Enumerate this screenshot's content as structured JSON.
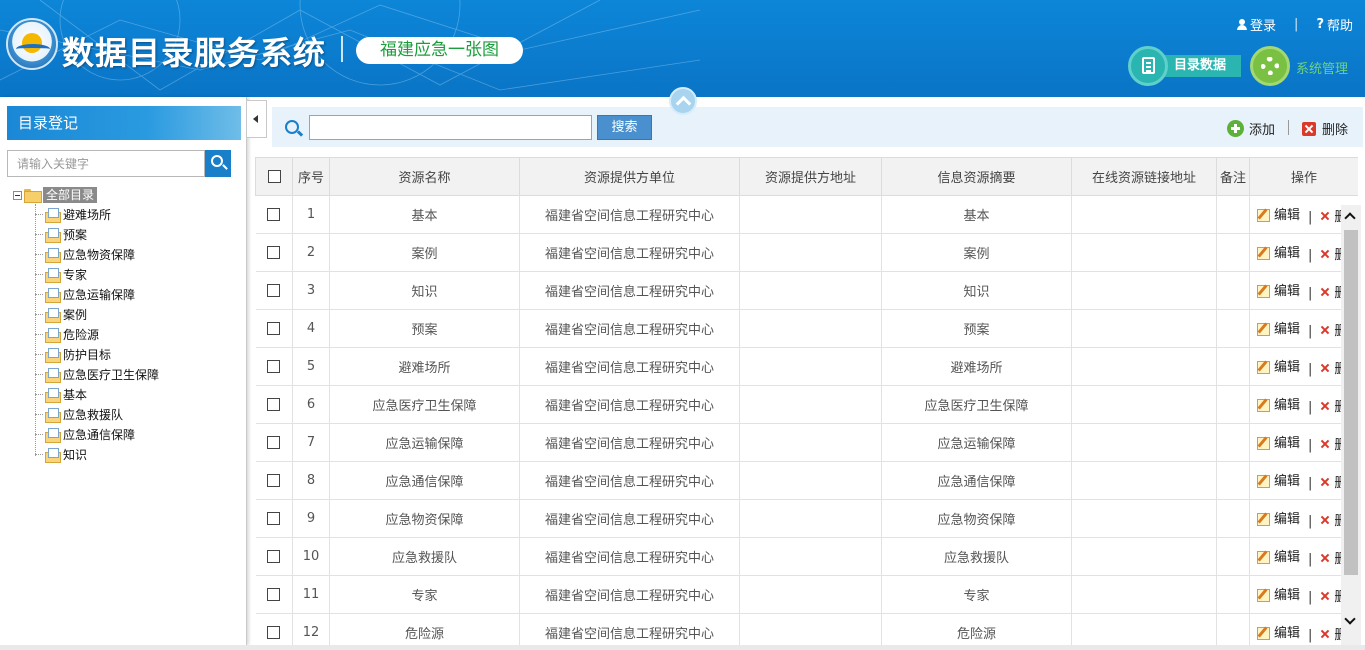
{
  "header": {
    "app_title": "数据目录服务系统",
    "subtitle": "福建应急一张图",
    "login_label": "登录",
    "help_label": "帮助",
    "nav": {
      "catalog_data": "目录数据",
      "system_admin": "系统管理"
    }
  },
  "sidebar": {
    "title": "目录登记",
    "search_placeholder": "请输入关键字",
    "tree": {
      "root": "全部目录",
      "items": [
        {
          "label": "避难场所"
        },
        {
          "label": "预案"
        },
        {
          "label": "应急物资保障"
        },
        {
          "label": "专家"
        },
        {
          "label": "应急运输保障"
        },
        {
          "label": "案例"
        },
        {
          "label": "危险源"
        },
        {
          "label": "防护目标"
        },
        {
          "label": "应急医疗卫生保障"
        },
        {
          "label": "基本"
        },
        {
          "label": "应急救援队"
        },
        {
          "label": "应急通信保障"
        },
        {
          "label": "知识"
        }
      ]
    }
  },
  "toolbar": {
    "search_value": "",
    "search_button": "搜索",
    "add_label": "添加",
    "delete_label": "删除"
  },
  "table": {
    "columns": [
      "序号",
      "资源名称",
      "资源提供方单位",
      "资源提供方地址",
      "信息资源摘要",
      "在线资源链接地址",
      "备注",
      "操作"
    ],
    "edit_label": "编辑",
    "delete_label": "删除",
    "rows": [
      {
        "no": "1",
        "name": "基本",
        "provider": "福建省空间信息工程研究中心",
        "address": "",
        "summary": "基本",
        "link": "",
        "note": ""
      },
      {
        "no": "2",
        "name": "案例",
        "provider": "福建省空间信息工程研究中心",
        "address": "",
        "summary": "案例",
        "link": "",
        "note": ""
      },
      {
        "no": "3",
        "name": "知识",
        "provider": "福建省空间信息工程研究中心",
        "address": "",
        "summary": "知识",
        "link": "",
        "note": ""
      },
      {
        "no": "4",
        "name": "预案",
        "provider": "福建省空间信息工程研究中心",
        "address": "",
        "summary": "预案",
        "link": "",
        "note": ""
      },
      {
        "no": "5",
        "name": "避难场所",
        "provider": "福建省空间信息工程研究中心",
        "address": "",
        "summary": "避难场所",
        "link": "",
        "note": ""
      },
      {
        "no": "6",
        "name": "应急医疗卫生保障",
        "provider": "福建省空间信息工程研究中心",
        "address": "",
        "summary": "应急医疗卫生保障",
        "link": "",
        "note": ""
      },
      {
        "no": "7",
        "name": "应急运输保障",
        "provider": "福建省空间信息工程研究中心",
        "address": "",
        "summary": "应急运输保障",
        "link": "",
        "note": ""
      },
      {
        "no": "8",
        "name": "应急通信保障",
        "provider": "福建省空间信息工程研究中心",
        "address": "",
        "summary": "应急通信保障",
        "link": "",
        "note": ""
      },
      {
        "no": "9",
        "name": "应急物资保障",
        "provider": "福建省空间信息工程研究中心",
        "address": "",
        "summary": "应急物资保障",
        "link": "",
        "note": ""
      },
      {
        "no": "10",
        "name": "应急救援队",
        "provider": "福建省空间信息工程研究中心",
        "address": "",
        "summary": "应急救援队",
        "link": "",
        "note": ""
      },
      {
        "no": "11",
        "name": "专家",
        "provider": "福建省空间信息工程研究中心",
        "address": "",
        "summary": "专家",
        "link": "",
        "note": ""
      },
      {
        "no": "12",
        "name": "危险源",
        "provider": "福建省空间信息工程研究中心",
        "address": "",
        "summary": "危险源",
        "link": "",
        "note": ""
      }
    ]
  },
  "colors": {
    "header_blue": "#0a74c6",
    "accent_green": "#1a9e3a",
    "teal": "#2bb5b0",
    "lime": "#7ac143",
    "delete_red": "#d93a2a"
  }
}
